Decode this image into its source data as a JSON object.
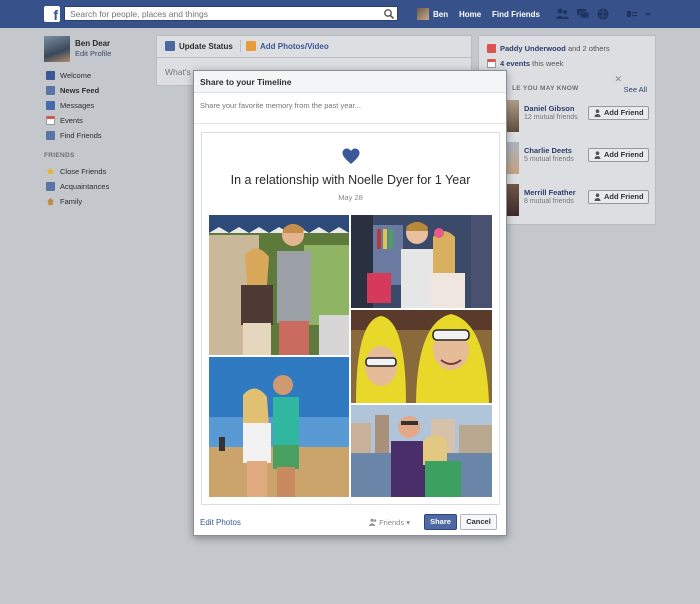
{
  "topbar": {
    "search_placeholder": "Search for people, places and things",
    "user_name": "Ben",
    "home": "Home",
    "find_friends": "Find Friends"
  },
  "sidebar": {
    "profile_name": "Ben Dear",
    "edit_profile": "Edit Profile",
    "items": [
      {
        "label": "Welcome",
        "icon": "facebook-icon",
        "color": "#3b5998"
      },
      {
        "label": "News Feed",
        "icon": "news-feed-icon",
        "color": "#5b74a8"
      },
      {
        "label": "Messages",
        "icon": "messages-icon",
        "color": "#4a6ab0"
      },
      {
        "label": "Events",
        "icon": "calendar-icon",
        "color": "#d9534f"
      },
      {
        "label": "Find Friends",
        "icon": "friends-icon",
        "color": "#5b74a8"
      }
    ],
    "friends_header": "FRIENDS",
    "friend_lists": [
      {
        "label": "Close Friends",
        "icon": "star-icon",
        "color": "#e8b520"
      },
      {
        "label": "Acquaintances",
        "icon": "acquaintances-icon",
        "color": "#5b74a8"
      },
      {
        "label": "Family",
        "icon": "home-icon",
        "color": "#c08a3e"
      }
    ]
  },
  "composer": {
    "update_status": "Update Status",
    "add_photos": "Add Photos/Video",
    "placeholder": "What's"
  },
  "right": {
    "notif_name": "Paddy Underwood",
    "notif_rest": "and 2 others",
    "events_bold": "4 events",
    "events_rest": "this week",
    "pymk_header": "LE YOU MAY KNOW",
    "see_all": "See All",
    "people": [
      {
        "name": "Daniel Gibson",
        "mutual": "12 mutual friends",
        "button": "Add Friend"
      },
      {
        "name": "Charlie Deets",
        "mutual": "5 mutual friends",
        "button": "Add Friend"
      },
      {
        "name": "Merrill Feather",
        "mutual": "8 mutual friends",
        "button": "Add Friend"
      }
    ]
  },
  "modal": {
    "title": "Share to your Timeline",
    "input_placeholder": "Share your favorite memory from the past year...",
    "card_title": "In a relationship with Noelle Dyer for 1 Year",
    "card_date": "May 28",
    "edit_photos": "Edit Photos",
    "privacy": "Friends",
    "share": "Share",
    "cancel": "Cancel"
  },
  "colors": {
    "topbar": "#37528a",
    "link": "#3b5998",
    "share_button": "#4e69a2",
    "heart": "#3b5998"
  }
}
